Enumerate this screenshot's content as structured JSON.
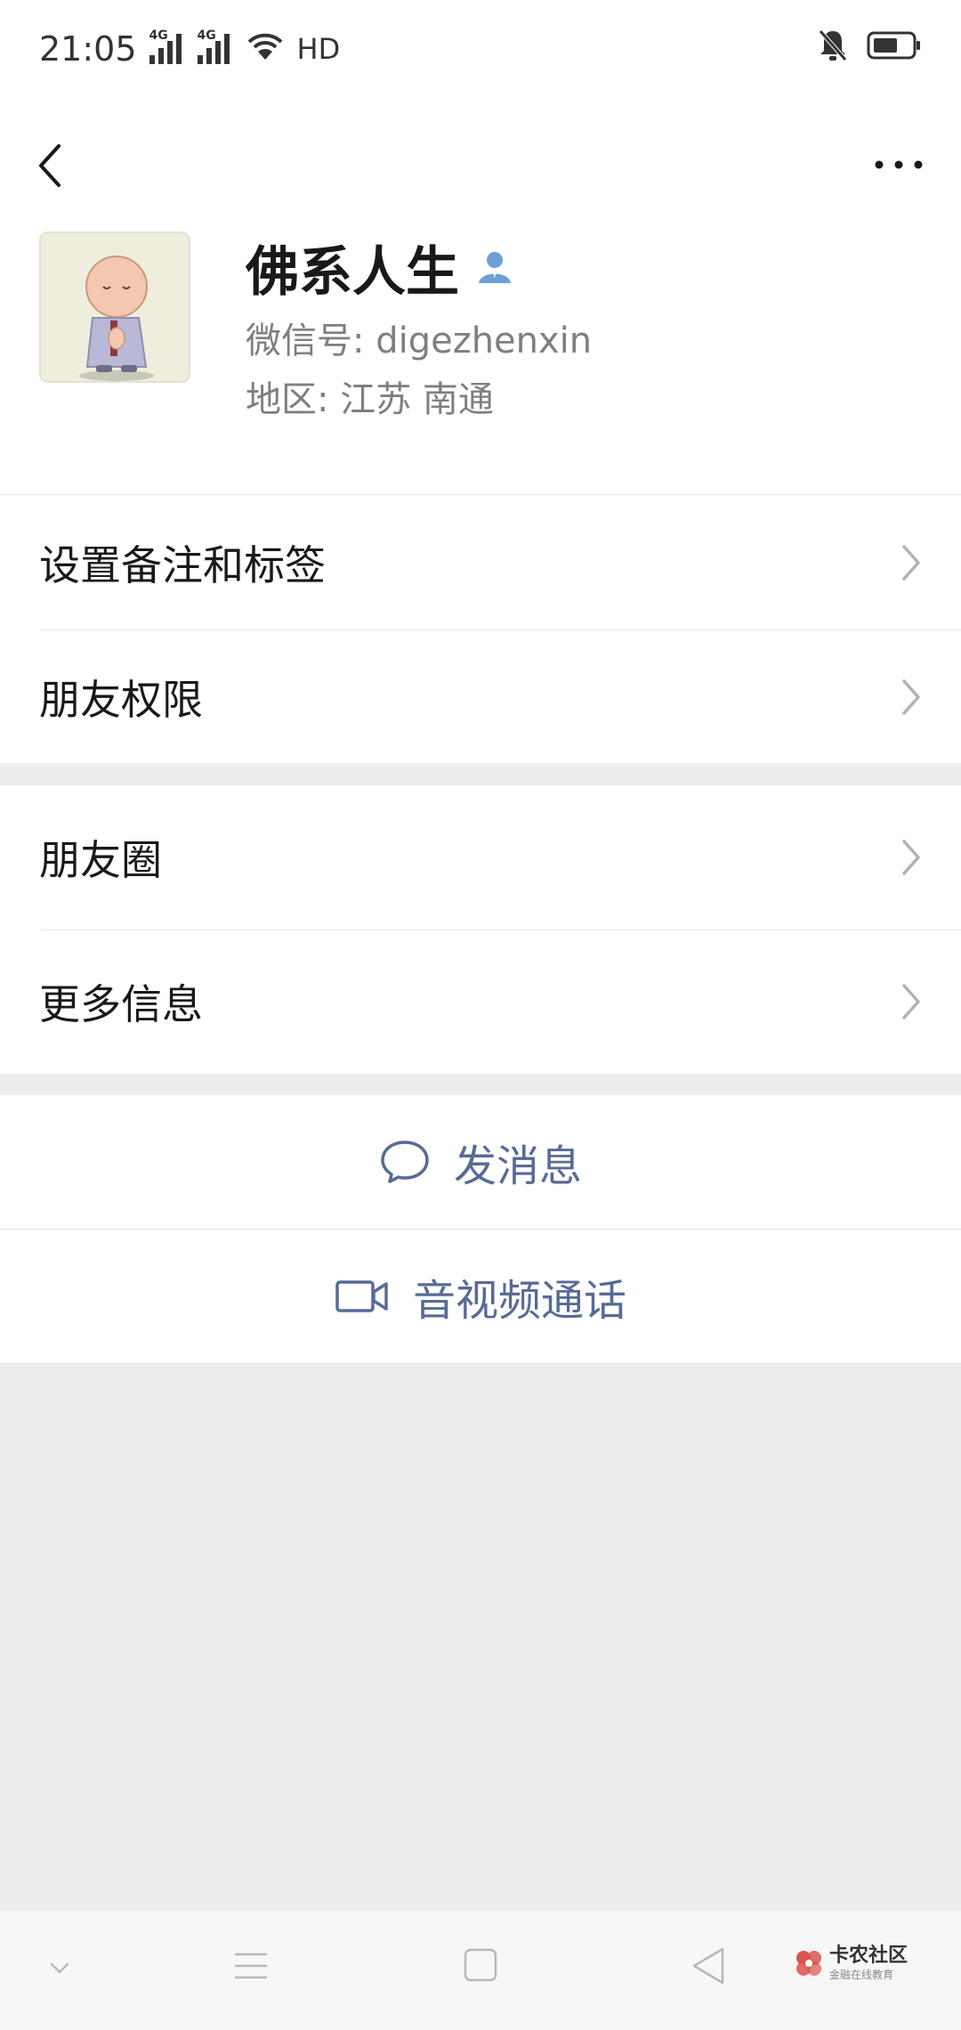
{
  "status_bar": {
    "time": "21:05",
    "net1": "4G",
    "net2": "4G",
    "hd": "HD",
    "icons": [
      "signal-icon",
      "signal-icon",
      "wifi-icon",
      "mute-icon",
      "battery-icon"
    ]
  },
  "profile": {
    "name": "佛系人生",
    "wechat_id": "微信号: digezhenxin",
    "region": "地区: 江苏 南通"
  },
  "menu": {
    "remark": "设置备注和标签",
    "permission": "朋友权限",
    "moments": "朋友圈",
    "more_info": "更多信息"
  },
  "actions": {
    "message": "发消息",
    "call": "音视频通话"
  },
  "watermark": {
    "title": "卡农社区",
    "subtitle": "金融在线教育"
  },
  "colors": {
    "link": "#576b95",
    "background": "#ededed"
  }
}
